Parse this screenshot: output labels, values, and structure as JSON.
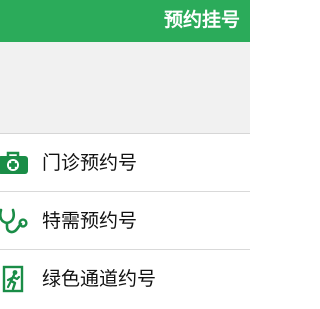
{
  "header": {
    "title": "预约挂号"
  },
  "menu": {
    "items": [
      {
        "label": "门诊预约号",
        "icon": "medical-kit-icon"
      },
      {
        "label": "特需预约号",
        "icon": "stethoscope-icon"
      },
      {
        "label": "绿色通道约号",
        "icon": "emergency-exit-icon"
      }
    ]
  },
  "colors": {
    "accent": "#2bab5a",
    "icon": "#1a8d47",
    "banner": "#f1f1f1",
    "text": "#111111"
  }
}
